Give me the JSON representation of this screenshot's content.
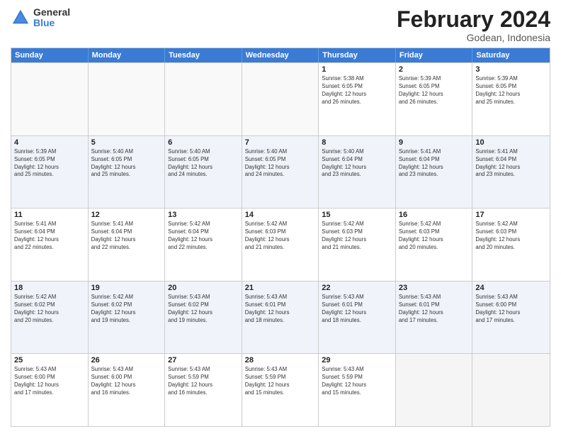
{
  "logo": {
    "general": "General",
    "blue": "Blue"
  },
  "title": {
    "month": "February 2024",
    "location": "Godean, Indonesia"
  },
  "header": {
    "days": [
      "Sunday",
      "Monday",
      "Tuesday",
      "Wednesday",
      "Thursday",
      "Friday",
      "Saturday"
    ]
  },
  "weeks": [
    {
      "cells": [
        {
          "day": "",
          "info": ""
        },
        {
          "day": "",
          "info": ""
        },
        {
          "day": "",
          "info": ""
        },
        {
          "day": "",
          "info": ""
        },
        {
          "day": "1",
          "info": "Sunrise: 5:38 AM\nSunset: 6:05 PM\nDaylight: 12 hours\nand 26 minutes."
        },
        {
          "day": "2",
          "info": "Sunrise: 5:39 AM\nSunset: 6:05 PM\nDaylight: 12 hours\nand 26 minutes."
        },
        {
          "day": "3",
          "info": "Sunrise: 5:39 AM\nSunset: 6:05 PM\nDaylight: 12 hours\nand 25 minutes."
        }
      ]
    },
    {
      "cells": [
        {
          "day": "4",
          "info": "Sunrise: 5:39 AM\nSunset: 6:05 PM\nDaylight: 12 hours\nand 25 minutes."
        },
        {
          "day": "5",
          "info": "Sunrise: 5:40 AM\nSunset: 6:05 PM\nDaylight: 12 hours\nand 25 minutes."
        },
        {
          "day": "6",
          "info": "Sunrise: 5:40 AM\nSunset: 6:05 PM\nDaylight: 12 hours\nand 24 minutes."
        },
        {
          "day": "7",
          "info": "Sunrise: 5:40 AM\nSunset: 6:05 PM\nDaylight: 12 hours\nand 24 minutes."
        },
        {
          "day": "8",
          "info": "Sunrise: 5:40 AM\nSunset: 6:04 PM\nDaylight: 12 hours\nand 23 minutes."
        },
        {
          "day": "9",
          "info": "Sunrise: 5:41 AM\nSunset: 6:04 PM\nDaylight: 12 hours\nand 23 minutes."
        },
        {
          "day": "10",
          "info": "Sunrise: 5:41 AM\nSunset: 6:04 PM\nDaylight: 12 hours\nand 23 minutes."
        }
      ]
    },
    {
      "cells": [
        {
          "day": "11",
          "info": "Sunrise: 5:41 AM\nSunset: 6:04 PM\nDaylight: 12 hours\nand 22 minutes."
        },
        {
          "day": "12",
          "info": "Sunrise: 5:41 AM\nSunset: 6:04 PM\nDaylight: 12 hours\nand 22 minutes."
        },
        {
          "day": "13",
          "info": "Sunrise: 5:42 AM\nSunset: 6:04 PM\nDaylight: 12 hours\nand 22 minutes."
        },
        {
          "day": "14",
          "info": "Sunrise: 5:42 AM\nSunset: 6:03 PM\nDaylight: 12 hours\nand 21 minutes."
        },
        {
          "day": "15",
          "info": "Sunrise: 5:42 AM\nSunset: 6:03 PM\nDaylight: 12 hours\nand 21 minutes."
        },
        {
          "day": "16",
          "info": "Sunrise: 5:42 AM\nSunset: 6:03 PM\nDaylight: 12 hours\nand 20 minutes."
        },
        {
          "day": "17",
          "info": "Sunrise: 5:42 AM\nSunset: 6:03 PM\nDaylight: 12 hours\nand 20 minutes."
        }
      ]
    },
    {
      "cells": [
        {
          "day": "18",
          "info": "Sunrise: 5:42 AM\nSunset: 6:02 PM\nDaylight: 12 hours\nand 20 minutes."
        },
        {
          "day": "19",
          "info": "Sunrise: 5:42 AM\nSunset: 6:02 PM\nDaylight: 12 hours\nand 19 minutes."
        },
        {
          "day": "20",
          "info": "Sunrise: 5:43 AM\nSunset: 6:02 PM\nDaylight: 12 hours\nand 19 minutes."
        },
        {
          "day": "21",
          "info": "Sunrise: 5:43 AM\nSunset: 6:01 PM\nDaylight: 12 hours\nand 18 minutes."
        },
        {
          "day": "22",
          "info": "Sunrise: 5:43 AM\nSunset: 6:01 PM\nDaylight: 12 hours\nand 18 minutes."
        },
        {
          "day": "23",
          "info": "Sunrise: 5:43 AM\nSunset: 6:01 PM\nDaylight: 12 hours\nand 17 minutes."
        },
        {
          "day": "24",
          "info": "Sunrise: 5:43 AM\nSunset: 6:00 PM\nDaylight: 12 hours\nand 17 minutes."
        }
      ]
    },
    {
      "cells": [
        {
          "day": "25",
          "info": "Sunrise: 5:43 AM\nSunset: 6:00 PM\nDaylight: 12 hours\nand 17 minutes."
        },
        {
          "day": "26",
          "info": "Sunrise: 5:43 AM\nSunset: 6:00 PM\nDaylight: 12 hours\nand 16 minutes."
        },
        {
          "day": "27",
          "info": "Sunrise: 5:43 AM\nSunset: 5:59 PM\nDaylight: 12 hours\nand 16 minutes."
        },
        {
          "day": "28",
          "info": "Sunrise: 5:43 AM\nSunset: 5:59 PM\nDaylight: 12 hours\nand 15 minutes."
        },
        {
          "day": "29",
          "info": "Sunrise: 5:43 AM\nSunset: 5:59 PM\nDaylight: 12 hours\nand 15 minutes."
        },
        {
          "day": "",
          "info": ""
        },
        {
          "day": "",
          "info": ""
        }
      ]
    }
  ]
}
